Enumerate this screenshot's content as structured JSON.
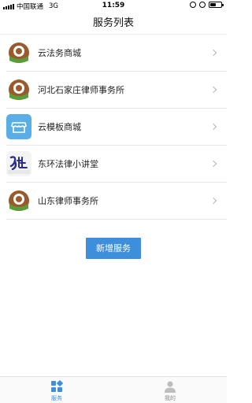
{
  "status_bar": {
    "carrier": "中国联通",
    "network": "3G",
    "time": "11:59"
  },
  "nav": {
    "title": "服务列表"
  },
  "services": [
    {
      "label": "云法务商城",
      "icon": "lawyer-logo-icon"
    },
    {
      "label": "河北石家庄律师事务所",
      "icon": "lawyer-logo-icon"
    },
    {
      "label": "云模板商城",
      "icon": "store-icon"
    },
    {
      "label": "东环法律小讲堂",
      "icon": "yunfa-logo-icon"
    },
    {
      "label": "山东律师事务所",
      "icon": "lawyer-logo-icon"
    }
  ],
  "add_button": {
    "label": "新增服务"
  },
  "tabs": [
    {
      "label": "服务",
      "icon": "grid-icon",
      "active": true
    },
    {
      "label": "我的",
      "icon": "user-icon",
      "active": false
    }
  ],
  "colors": {
    "accent": "#3d8fdb",
    "logo_brown": "#9a5a2c",
    "logo_green": "#5a9e3a",
    "store_blue": "#5aaee8"
  }
}
